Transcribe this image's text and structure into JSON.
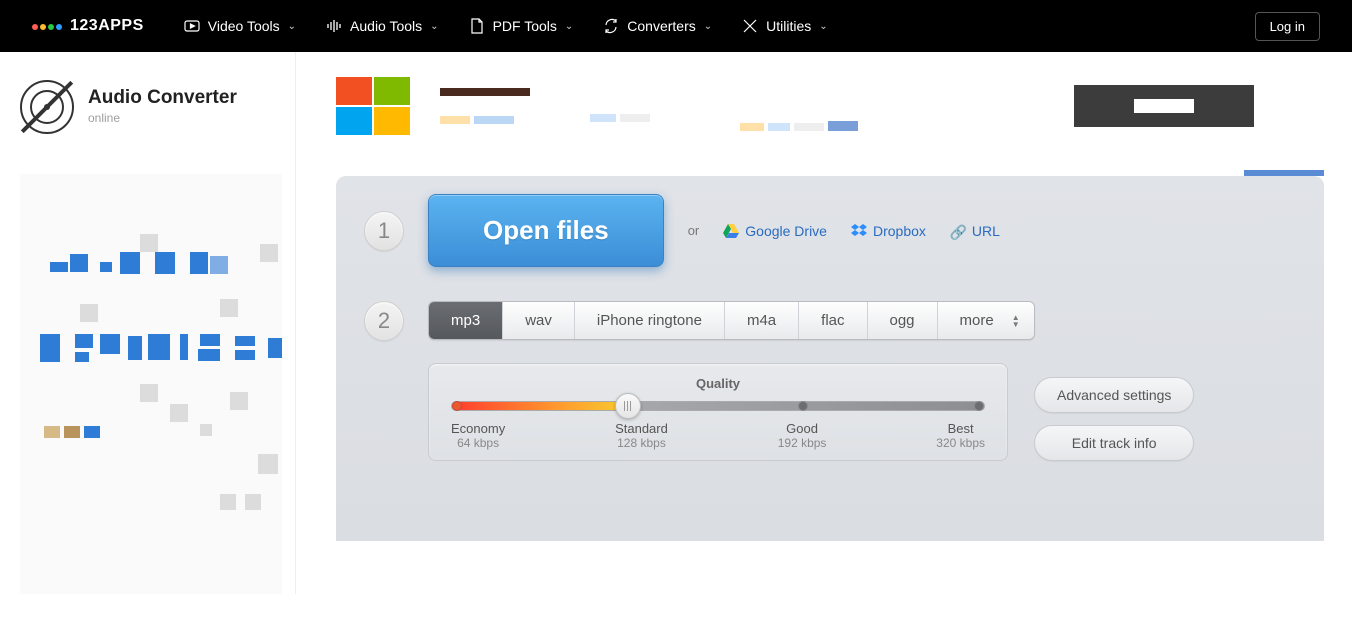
{
  "brand": "123APPS",
  "nav": {
    "video": "Video Tools",
    "audio": "Audio Tools",
    "pdf": "PDF Tools",
    "converters": "Converters",
    "utilities": "Utilities"
  },
  "login": "Log in",
  "app": {
    "title": "Audio Converter",
    "subtitle": "online"
  },
  "step1": {
    "open": "Open files",
    "or": "or",
    "gdrive": "Google Drive",
    "dropbox": "Dropbox",
    "url": "URL"
  },
  "step2": {
    "formats": {
      "mp3": "mp3",
      "wav": "wav",
      "iphone": "iPhone ringtone",
      "m4a": "m4a",
      "flac": "flac",
      "ogg": "ogg",
      "more": "more"
    },
    "quality": {
      "title": "Quality",
      "economy": {
        "label": "Economy",
        "rate": "64 kbps"
      },
      "standard": {
        "label": "Standard",
        "rate": "128 kbps"
      },
      "good": {
        "label": "Good",
        "rate": "192 kbps"
      },
      "best": {
        "label": "Best",
        "rate": "320 kbps"
      }
    },
    "advanced": "Advanced settings",
    "edit_track": "Edit track info"
  }
}
